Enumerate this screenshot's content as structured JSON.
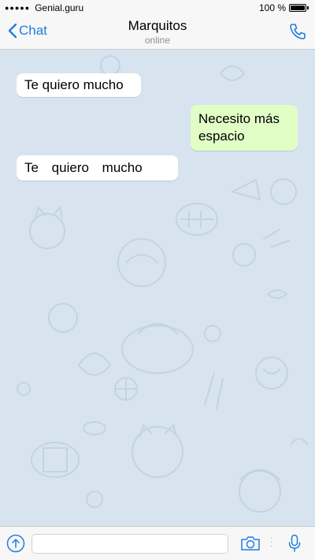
{
  "status_bar": {
    "signal": "●●●●●",
    "carrier": "Genial.guru",
    "battery_text": "100 %"
  },
  "nav": {
    "back_label": "Chat",
    "title": "Marquitos",
    "subtitle": "online",
    "back_icon": "chevron-left-icon",
    "call_icon": "phone-icon"
  },
  "messages": [
    {
      "direction": "incoming",
      "text": "Te quiero mucho"
    },
    {
      "direction": "outgoing",
      "text": "Necesito más espacio"
    },
    {
      "direction": "incoming",
      "text": "Te quiero mucho"
    }
  ],
  "input": {
    "value": "",
    "placeholder": "",
    "attach_icon": "arrow-up-icon",
    "camera_icon": "camera-icon",
    "mic_icon": "microphone-icon"
  },
  "colors": {
    "accent": "#1f7fdb",
    "chat_background": "#d7e4ef",
    "incoming_bubble": "#ffffff",
    "outgoing_bubble": "#e1fec6"
  }
}
